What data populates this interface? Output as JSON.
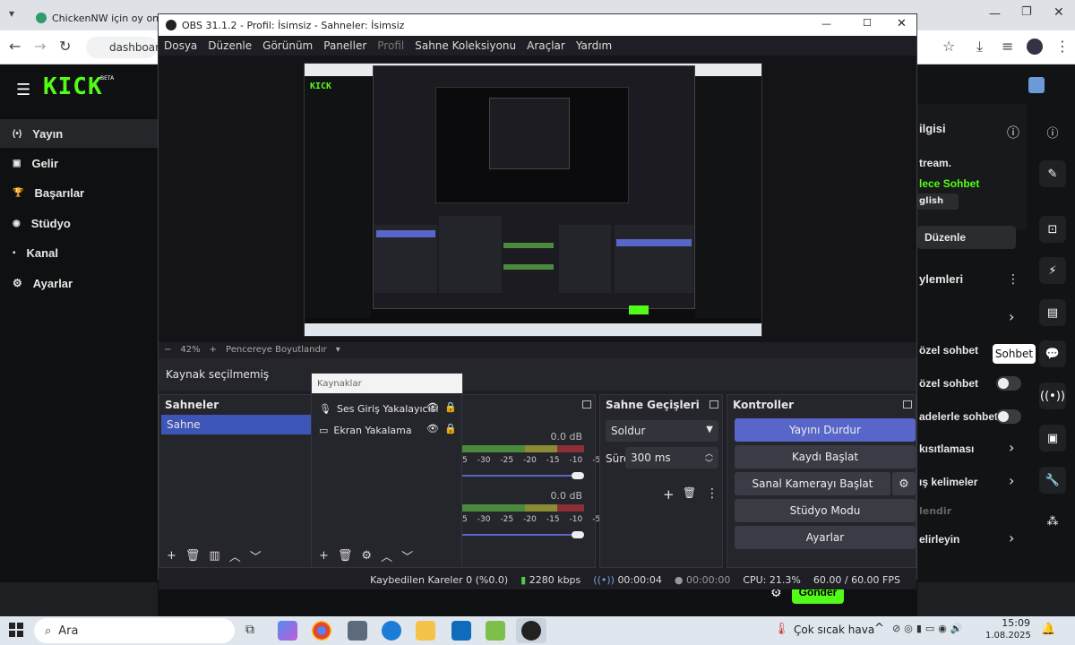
{
  "browser": {
    "tab1": "ChickenNW için oy onayı",
    "address": "dashboard"
  },
  "kick": {
    "logo": "KICK",
    "logo_badge": "BETA",
    "nav": [
      {
        "label": "Yayın",
        "icon": "(•)"
      },
      {
        "label": "Gelir",
        "icon": "▣"
      },
      {
        "label": "Başarılar",
        "icon": "🏆"
      },
      {
        "label": "Stüdyo",
        "icon": "◉"
      },
      {
        "label": "Kanal",
        "icon": "▪"
      },
      {
        "label": "Ayarlar",
        "icon": "⚙"
      }
    ],
    "right": {
      "info_title": "ilgisi",
      "stream_text": "tream.",
      "chat_link": "lece Sohbet",
      "lang": "glish",
      "edit_button": "Düzenle",
      "settings_title": "ylemleri",
      "private_chat": "özel sohbet",
      "private_chat2": "özel sohbet",
      "followers_chat": "adelerle sohbet",
      "restriction": "kısıtlaması",
      "keywords": "ış kelimeler",
      "muted": "lendir",
      "specify": "elirleyin",
      "tooltip": "Sohbet"
    },
    "send_button": "Gönder"
  },
  "obs": {
    "title": "OBS 31.1.2 - Profil: İsimsiz - Sahneler: İsimsiz",
    "menu": [
      "Dosya",
      "Düzenle",
      "Görünüm",
      "Paneller",
      "Profil",
      "Sahne Koleksiyonu",
      "Araçlar",
      "Yardım"
    ],
    "zoom": {
      "minus": "−",
      "value": "42%",
      "plus": "+",
      "fit": "Pencereye Boyutlandır"
    },
    "no_source": "Kaynak seçilmemiş",
    "scenes": {
      "title": "Sahneler",
      "items": [
        "Sahne"
      ]
    },
    "sources": {
      "title": "Kaynaklar",
      "items": [
        "Ses Giriş Yakalayıcısı",
        "Ekran Yakalama"
      ]
    },
    "mixer": {
      "db1": "0.0 dB",
      "db2": "0.0 dB",
      "ticks": [
        "5",
        "-30",
        "-25",
        "-20",
        "-15",
        "-10",
        "-5",
        "0"
      ]
    },
    "transitions": {
      "title": "Sahne Geçişleri",
      "type": "Soldur",
      "duration_label": "Süre",
      "duration": "300 ms"
    },
    "controls": {
      "title": "Kontroller",
      "stop_stream": "Yayını Durdur",
      "start_record": "Kaydı Başlat",
      "virtual_cam": "Sanal Kamerayı Başlat",
      "studio_mode": "Stüdyo Modu",
      "settings": "Ayarlar"
    },
    "status": {
      "dropped": "Kaybedilen Kareler 0 (%0.0)",
      "bitrate": "2280 kbps",
      "stream_time": "00:00:04",
      "record_time": "00:00:00",
      "cpu": "CPU: 21.3%",
      "fps": "60.00 / 60.00 FPS"
    }
  },
  "taskbar": {
    "search": "Ara",
    "weather": "Çok sıcak hava",
    "time": "15:09",
    "date": "1.08.2025"
  },
  "colors": {
    "kick_green": "#53fc18",
    "obs_accent": "#5865c9"
  }
}
